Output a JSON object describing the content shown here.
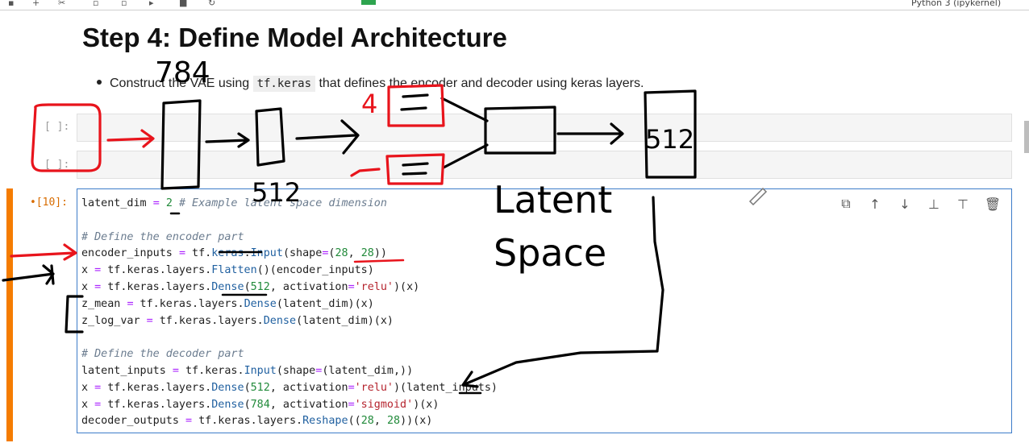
{
  "top_bar": {
    "kernel_label": "Python 3 (ipykernel)"
  },
  "markdown": {
    "title": "Step 4: Define Model Architecture",
    "bullet": {
      "before": "Construct the VAE using ",
      "code": "tf.keras",
      "after": " that defines the encoder and decoder using keras layers."
    }
  },
  "cells": [
    {
      "prompt": "[ ]:"
    },
    {
      "prompt": "[ ]:"
    }
  ],
  "active_cell": {
    "prompt": "•[10]:"
  },
  "cell_toolbar": {
    "icons": [
      "duplicate-icon",
      "move-up-icon",
      "move-down-icon",
      "insert-above-icon",
      "insert-below-icon",
      "delete-icon"
    ]
  },
  "annotations": {
    "n784": "784",
    "n512a": "512",
    "n512b": "512",
    "n4": "4",
    "latent": "Latent",
    "space": "Space"
  },
  "colors": {
    "active_bar": "#f57c00",
    "cell_border": "#3d7cc9",
    "ink_red": "#e8141c",
    "ink_black": "#000000"
  }
}
